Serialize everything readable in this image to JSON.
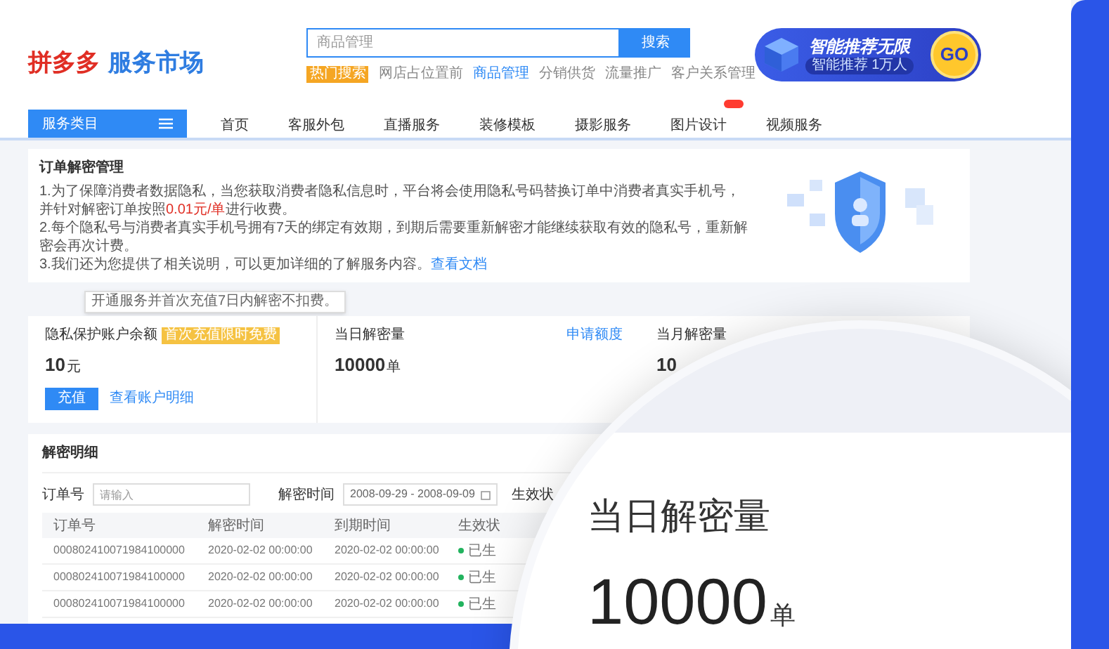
{
  "header": {
    "logo_brand": "拼多多",
    "logo_service": "服务市场",
    "search": {
      "placeholder": "商品管理",
      "button": "搜索"
    },
    "hot_label": "热门搜索",
    "hot_tags": [
      {
        "label": "网店占位置前",
        "selected": false
      },
      {
        "label": "商品管理",
        "selected": true
      },
      {
        "label": "分销供货",
        "selected": false
      },
      {
        "label": "流量推广",
        "selected": false
      },
      {
        "label": "客户关系管理",
        "selected": false
      }
    ],
    "promo": {
      "title": "智能推荐无限",
      "subtitle": "智能推荐 1万人",
      "go": "GO"
    }
  },
  "nav": {
    "category_button": "服务类目",
    "items": [
      {
        "label": "首页",
        "badge": false
      },
      {
        "label": "客服外包",
        "badge": false
      },
      {
        "label": "直播服务",
        "badge": false
      },
      {
        "label": "装修模板",
        "badge": false
      },
      {
        "label": "摄影服务",
        "badge": false
      },
      {
        "label": "图片设计",
        "badge": true
      },
      {
        "label": "视频服务",
        "badge": false
      }
    ]
  },
  "notice": {
    "title": "订单解密管理",
    "paragraphs": [
      {
        "segments": [
          {
            "kind": "plain",
            "text": "1.为了保障消费者数据隐私，当您获取消费者隐私信息时，平台将会使用隐私号码替换订单中消费者真实手机号，并针对解密订单按照"
          },
          {
            "kind": "highlight",
            "text": "0.01元/单"
          },
          {
            "kind": "plain",
            "text": "进行收费。"
          }
        ]
      },
      {
        "segments": [
          {
            "kind": "plain",
            "text": "2.每个隐私号与消费者真实手机号拥有7天的绑定有效期，到期后需要重新解密才能继续获取有效的隐私号，重新解密会再次计费。"
          }
        ]
      },
      {
        "segments": [
          {
            "kind": "plain",
            "text": "3.我们还为您提供了相关说明，可以更加详细的了解服务内容。"
          },
          {
            "kind": "link",
            "text": "查看文档"
          }
        ]
      }
    ]
  },
  "tooltip": "开通服务并首次充值7日内解密不扣费。",
  "stats": [
    {
      "kind": "balance",
      "label": "隐私保护账户余额",
      "badge": "首次充值限时免费",
      "value": "10",
      "unit": "元",
      "button": "充值",
      "link": "查看账户明细"
    },
    {
      "kind": "count",
      "label": "当日解密量",
      "value": "10000",
      "unit": "单",
      "link": "申请额度"
    },
    {
      "kind": "count",
      "label": "当月解密量",
      "value": "10"
    }
  ],
  "details": {
    "title": "解密明细",
    "filters": [
      {
        "kind": "input",
        "label": "订单号",
        "placeholder": "请输入"
      },
      {
        "kind": "daterange",
        "label": "解密时间",
        "value": "2008-09-29 - 2008-09-09"
      },
      {
        "kind": "label",
        "label": "生效状"
      }
    ],
    "columns": [
      "订单号",
      "解密时间",
      "到期时间",
      "生效状"
    ],
    "rows": [
      {
        "order": "000802410071984100000",
        "decrypt_time": "2020-02-02 00:00:00",
        "expire_time": "2020-02-02 00:00:00",
        "status": "已生"
      },
      {
        "order": "000802410071984100000",
        "decrypt_time": "2020-02-02 00:00:00",
        "expire_time": "2020-02-02 00:00:00",
        "status": "已生"
      },
      {
        "order": "000802410071984100000",
        "decrypt_time": "2020-02-02 00:00:00",
        "expire_time": "2020-02-02 00:00:00",
        "status": "已生"
      }
    ]
  },
  "magnifier": {
    "label": "当日解密量",
    "value": "10000",
    "unit": "单"
  }
}
